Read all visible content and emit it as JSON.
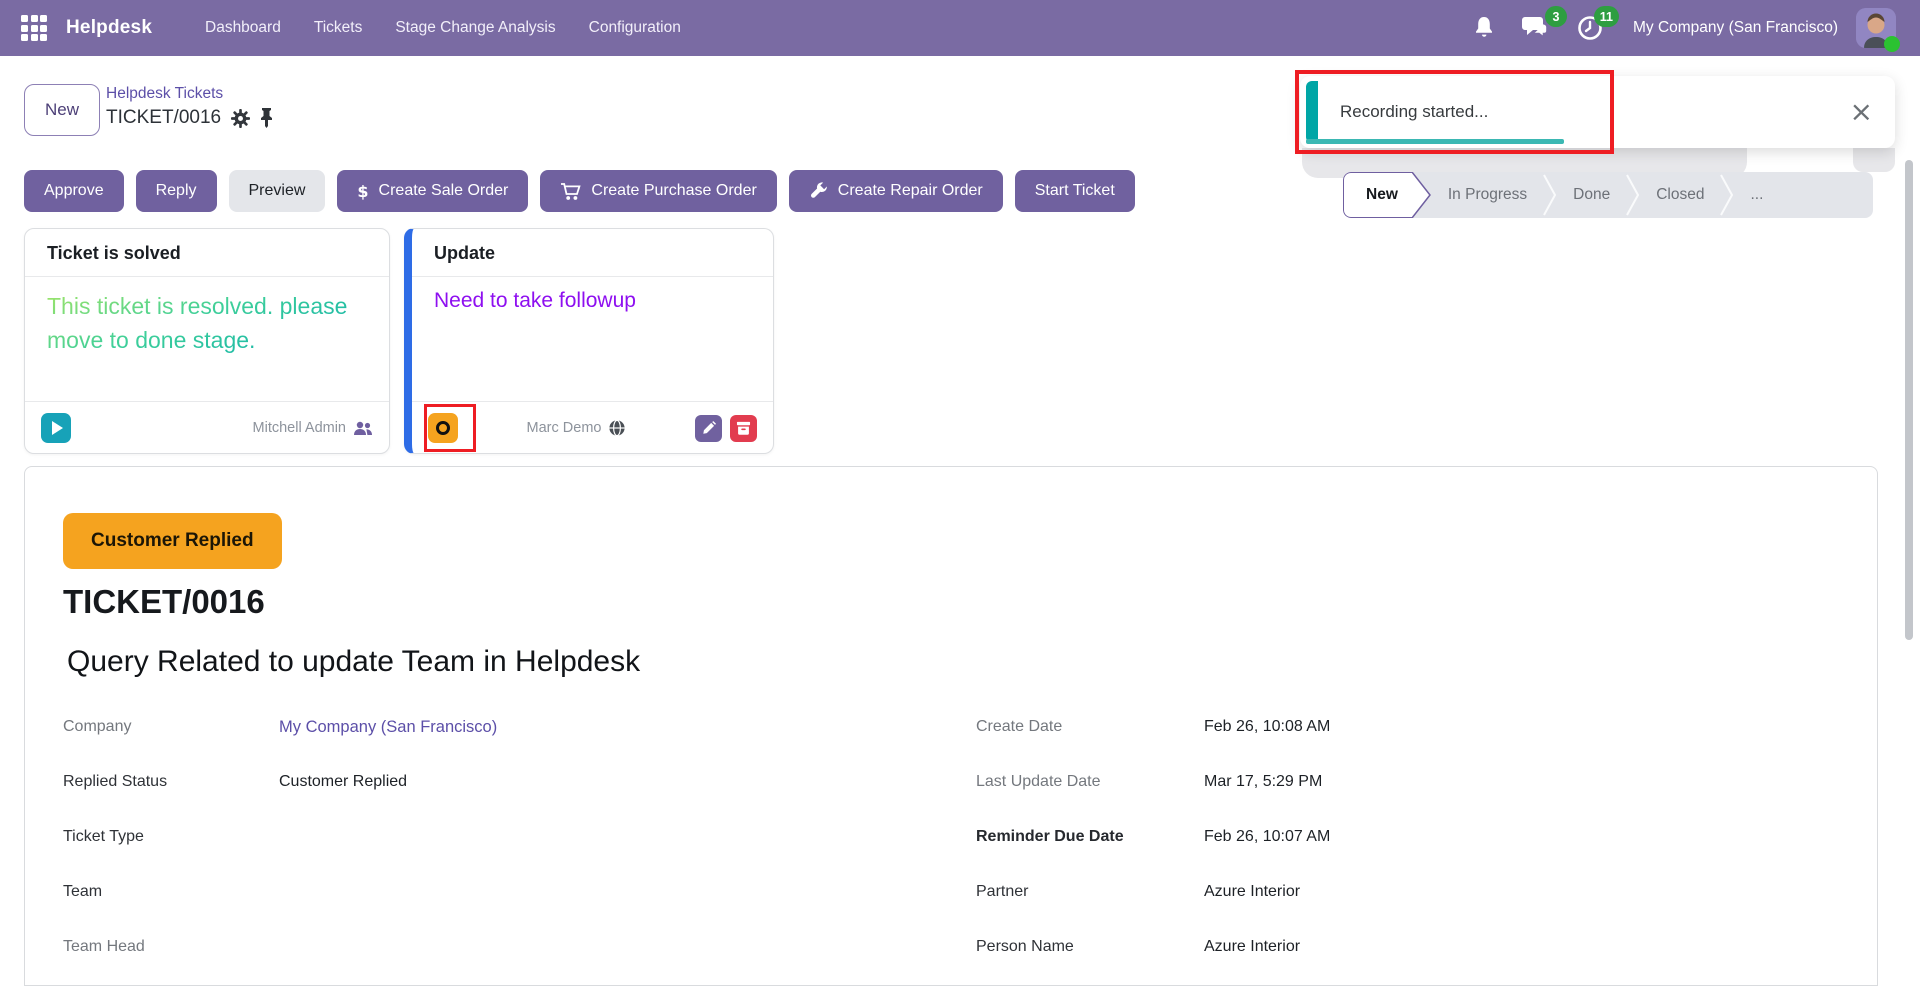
{
  "nav": {
    "brand": "Helpdesk",
    "items": [
      {
        "label": "Dashboard"
      },
      {
        "label": "Tickets"
      },
      {
        "label": "Stage Change Analysis"
      },
      {
        "label": "Configuration"
      }
    ],
    "messages_badge": "3",
    "activities_badge": "11",
    "company": "My Company (San Francisco)"
  },
  "breadcrumb": {
    "new_button": "New",
    "parent": "Helpdesk Tickets",
    "current": "TICKET/0016"
  },
  "toast": {
    "message": "Recording started..."
  },
  "actions": {
    "approve": "Approve",
    "reply": "Reply",
    "preview": "Preview",
    "create_sale_order": "Create Sale Order",
    "create_purchase_order": "Create Purchase Order",
    "create_repair_order": "Create Repair Order",
    "start_ticket": "Start Ticket"
  },
  "stages": [
    {
      "label": "New",
      "active": true
    },
    {
      "label": "In Progress",
      "active": false
    },
    {
      "label": "Done",
      "active": false
    },
    {
      "label": "Closed",
      "active": false
    },
    {
      "label": "...",
      "active": false
    }
  ],
  "cards": [
    {
      "title": "Ticket is solved",
      "body": "This ticket is resolved. please move to done stage.",
      "author": "Mitchell Admin"
    },
    {
      "title": "Update",
      "body": "Need to take followup",
      "author": "Marc Demo"
    }
  ],
  "ticket": {
    "status_badge": "Customer Replied",
    "reference": "TICKET/0016",
    "subject": "Query Related to update Team in Helpdesk",
    "fields_left": [
      {
        "label": "Company",
        "value": "My Company (San Francisco)"
      },
      {
        "label": "Replied Status",
        "value": "Customer Replied"
      },
      {
        "label": "Ticket Type",
        "value": ""
      },
      {
        "label": "Team",
        "value": ""
      },
      {
        "label": "Team Head",
        "value": ""
      }
    ],
    "fields_right": [
      {
        "label": "Create Date",
        "value": "Feb 26, 10:08 AM"
      },
      {
        "label": "Last Update Date",
        "value": "Mar 17, 5:29 PM"
      },
      {
        "label": "Reminder Due Date",
        "value": "Feb 26, 10:07 AM"
      },
      {
        "label": "Partner",
        "value": "Azure Interior"
      },
      {
        "label": "Person Name",
        "value": "Azure Interior"
      }
    ]
  },
  "icons": {
    "play": "▶",
    "close": "×",
    "dollar": "$"
  },
  "colors": {
    "nav_purple": "#7a6ba3",
    "button_purple": "#70619f",
    "link_purple": "#5c4fa8",
    "badge_orange": "#f5a31f",
    "toast_teal": "#00a6a6",
    "play_teal": "#17a2b8",
    "annotation_red": "#ee1d23",
    "delete_red": "#e23c4f",
    "notification_green": "#2e9e41",
    "online_green": "#2bc231",
    "update_blue_bar": "#2e6ce6",
    "violet_note": "#8e0ff0",
    "gradient_green_start": "#a2e567",
    "gradient_teal_end": "#12b3ab",
    "pipeline_gray": "#e3e5ea"
  }
}
